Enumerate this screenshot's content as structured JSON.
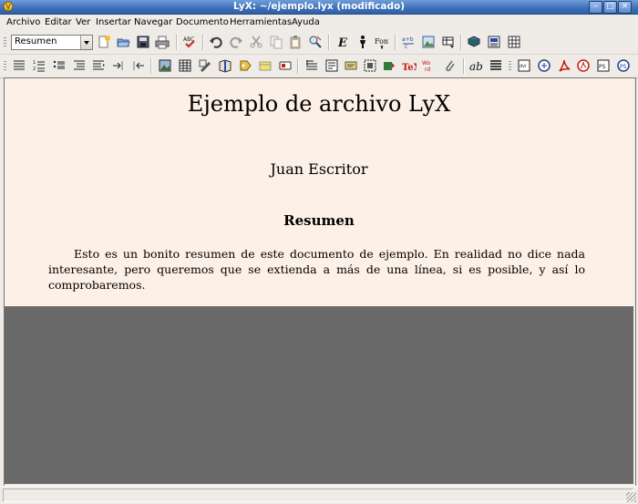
{
  "window": {
    "title": "LyX: ~/ejemplo.lyx (modificado)"
  },
  "menubar": {
    "items": [
      "Archivo",
      "Editar",
      "Ver",
      "Insertar",
      "Navegar",
      "Documento",
      "Herramientas",
      "Ayuda"
    ]
  },
  "toolbar": {
    "layout_select_value": "Resumen"
  },
  "document": {
    "title": "Ejemplo de archivo LyX",
    "author": "Juan Escritor",
    "abstract_heading": "Resumen",
    "abstract_lines": [
      "Esto es un bonito resumen de este documento de ejemplo. En realidad no dice nada",
      "interesante, pero queremos que se extienda a más de una línea, si es posible, y así lo",
      "comprobaremos."
    ]
  },
  "statusbar": {
    "text": ""
  },
  "colors": {
    "titlebar": "#3d6fb8",
    "document_bg": "#fdf0e6",
    "workarea_bg": "#696969"
  },
  "icons_toolbar1": [
    "new-file-icon",
    "open-file-icon",
    "save-icon",
    "print-icon",
    "spellcheck-icon",
    "undo-icon",
    "redo-icon",
    "cut-icon",
    "copy-icon",
    "paste-icon",
    "find-replace-icon",
    "emphasis-icon",
    "noun-icon",
    "font-icon",
    "math-icon",
    "graphics-icon",
    "table-icon",
    "toc-icon",
    "view-icon",
    "update-icon"
  ],
  "icons_toolbar2": [
    "itemize-icon",
    "enumerate-icon",
    "description-icon",
    "indent-less-icon",
    "indent-more-icon",
    "depth-increase-icon",
    "depth-decrease-icon",
    "insert-figure-icon",
    "insert-table-icon",
    "insert-graphics-icon",
    "insert-cite-icon",
    "insert-label-icon",
    "insert-ref-icon",
    "insert-note-icon",
    "insert-footnote-icon",
    "insert-margin-icon",
    "insert-box-icon",
    "insert-minipage-icon",
    "insert-tex-icon",
    "insert-url-icon",
    "insert-attach-icon",
    "text-style-icon",
    "paragraph-icon",
    "dvi-icon",
    "ps-icon",
    "pdf-icon",
    "pdf-view-icon",
    "ps-view-icon",
    "reload-icon"
  ]
}
